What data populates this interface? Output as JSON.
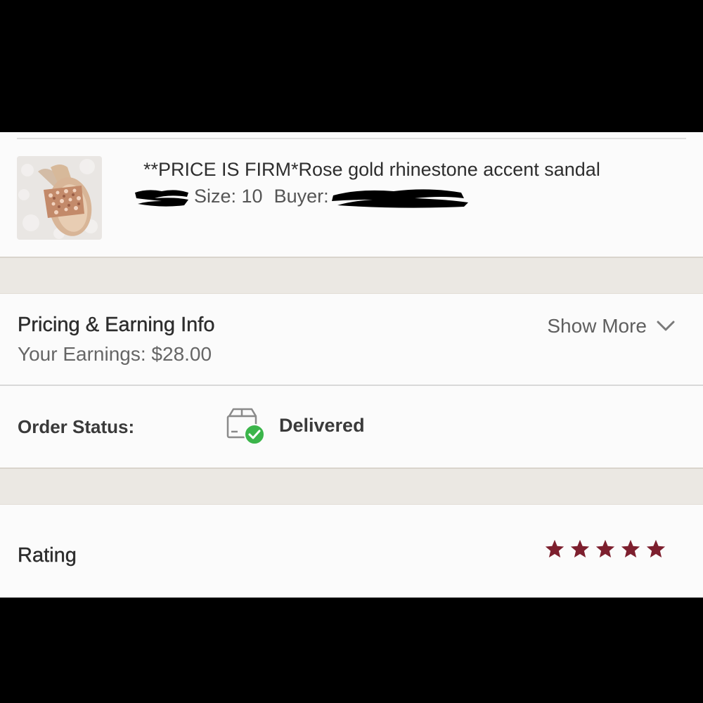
{
  "product": {
    "title": "**PRICE IS FIRM*Rose gold rhinestone accent sandal",
    "size_label": "Size: 10",
    "buyer_label": "Buyer:",
    "thumbnail": "rose-gold-sandal-photo"
  },
  "pricing": {
    "title": "Pricing & Earning Info",
    "earnings": "Your Earnings: $28.00",
    "show_more_label": "Show More"
  },
  "order_status": {
    "label": "Order Status:",
    "value": "Delivered",
    "icon": "package-delivered-icon"
  },
  "rating": {
    "label": "Rating",
    "stars": 5,
    "max_stars": 5,
    "star_color": "#7d1f2e"
  },
  "colors": {
    "check_green": "#3bb54a",
    "band": "#ebe8e3"
  }
}
